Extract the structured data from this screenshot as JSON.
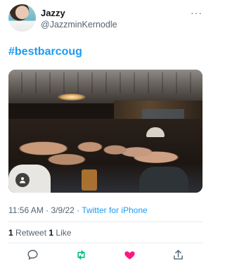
{
  "tweet": {
    "author": {
      "display_name": "Jazzy",
      "handle": "@JazzminKernodle"
    },
    "more_icon": "more-dots-icon",
    "text": "#bestbarcoug",
    "media": {
      "type": "photo",
      "badge_icon": "person-icon"
    },
    "timestamp": "11:56 AM · 3/9/22 · ",
    "source": "Twitter for iPhone",
    "stats": {
      "retweet_count": "1",
      "retweet_label": " Retweet ",
      "like_count": "1",
      "like_label": " Like"
    },
    "actions": [
      {
        "name": "reply",
        "icon": "reply-icon"
      },
      {
        "name": "retweet",
        "icon": "retweet-icon"
      },
      {
        "name": "like",
        "icon": "heart-icon"
      },
      {
        "name": "share",
        "icon": "share-icon"
      }
    ]
  },
  "colors": {
    "link": "#1d9bf0",
    "text": "#0f1419",
    "secondary": "#536471",
    "retweet": "#00ba7c",
    "like": "#f91880"
  }
}
